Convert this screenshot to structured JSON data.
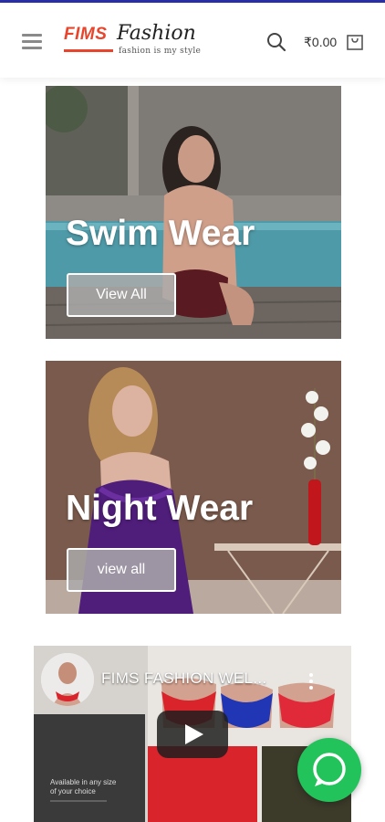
{
  "header": {
    "logo_primary": "FIMS",
    "logo_secondary": "Fashion",
    "tagline": "fashion is my style",
    "cart_total": "₹0.00"
  },
  "categories": [
    {
      "title": "Swim Wear",
      "button": "View All"
    },
    {
      "title": "Night Wear",
      "button": "view all"
    }
  ],
  "video": {
    "title": "FIMS FASHION WEL...",
    "caption": "Available in any size of your choice"
  },
  "colors": {
    "top_bar": "#2a2fa8",
    "brand_red": "#e8452c",
    "whatsapp_green": "#22c35a"
  },
  "icons": [
    "menu-icon",
    "search-icon",
    "cart-icon",
    "play-icon",
    "more-vert-icon",
    "whatsapp-icon"
  ]
}
